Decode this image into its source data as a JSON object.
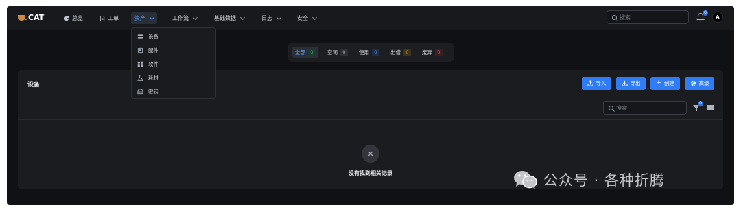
{
  "brand": {
    "name": "CAT"
  },
  "nav": {
    "items": [
      {
        "label": "总览",
        "icon": "dashboard-icon",
        "has_dropdown": false
      },
      {
        "label": "工单",
        "icon": "document-icon",
        "has_dropdown": false
      },
      {
        "label": "资产",
        "icon": "",
        "has_dropdown": true,
        "active": true
      },
      {
        "label": "工作流",
        "icon": "",
        "has_dropdown": true
      },
      {
        "label": "基础数据",
        "icon": "",
        "has_dropdown": true
      },
      {
        "label": "日志",
        "icon": "",
        "has_dropdown": true
      },
      {
        "label": "安全",
        "icon": "",
        "has_dropdown": true
      }
    ]
  },
  "header": {
    "search_placeholder": "搜索",
    "notification_count": "0",
    "avatar_initial": "A"
  },
  "asset_menu": {
    "items": [
      {
        "label": "设备",
        "icon": "device-icon"
      },
      {
        "label": "配件",
        "icon": "chip-icon"
      },
      {
        "label": "软件",
        "icon": "apps-icon"
      },
      {
        "label": "耗材",
        "icon": "flask-icon"
      },
      {
        "label": "密钥",
        "icon": "key-icon"
      }
    ]
  },
  "status_tabs": [
    {
      "label": "全部",
      "count": "0",
      "color": "#3fb37f",
      "active": true
    },
    {
      "label": "空闲",
      "count": "0",
      "color": "#8a8f99"
    },
    {
      "label": "使用",
      "count": "0",
      "color": "#4a8cf0"
    },
    {
      "label": "出借",
      "count": "0",
      "color": "#d9a020"
    },
    {
      "label": "废弃",
      "count": "0",
      "color": "#e05050"
    }
  ],
  "card": {
    "title": "设备",
    "buttons": {
      "import": "导入",
      "export": "导出",
      "create": "创建",
      "advanced": "高级"
    },
    "table_search_placeholder": "搜索",
    "filter_count": "0",
    "empty_text": "没有找到相关记录"
  },
  "watermark": {
    "text": "公众号 · 各种折腾"
  },
  "colors": {
    "accent": "#2f7cf6",
    "background": "#101114",
    "panel": "#1b1c20"
  }
}
